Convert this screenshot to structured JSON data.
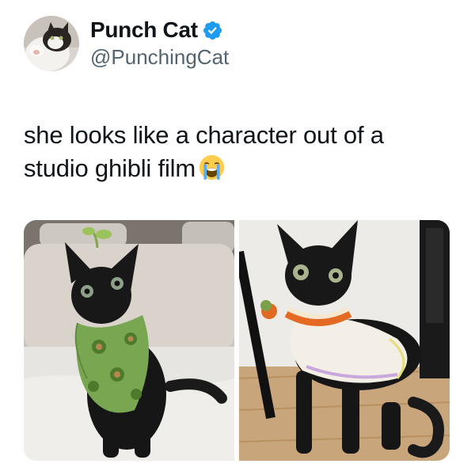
{
  "tweet": {
    "author": {
      "display_name": "Punch Cat",
      "handle": "@PunchingCat",
      "verified": true,
      "verified_icon": "verified-badge-icon",
      "avatar": "avatar-cat-photo"
    },
    "text": "she looks like a character out of a studio ghibli film",
    "emoji": "loudly-crying-face-emoji",
    "media": [
      {
        "name": "photo-cat-green-bandana",
        "icon": "cat-photo"
      },
      {
        "name": "photo-cat-crochet-sweater",
        "icon": "cat-photo"
      }
    ]
  },
  "colors": {
    "verified_blue": "#1d9bf0",
    "handle_gray": "#536471",
    "text": "#0f1419"
  }
}
